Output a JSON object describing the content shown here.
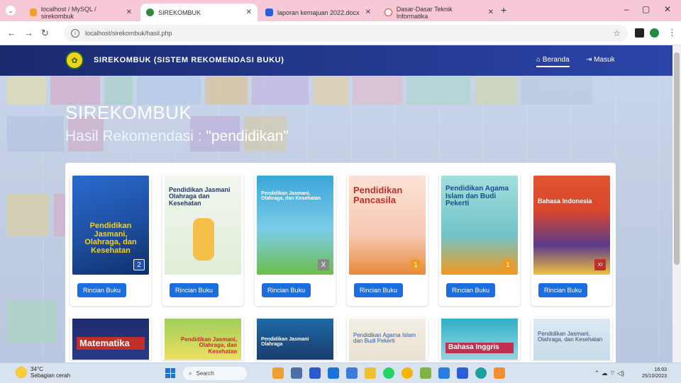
{
  "browser": {
    "tabs": [
      {
        "title": "localhost / MySQL / sirekombuk",
        "color": "#f0a030"
      },
      {
        "title": "SIREKOMBUK",
        "color": "#2e8b3a"
      },
      {
        "title": "laporan kemajuan 2022.docx",
        "color": "#2b5fd9"
      },
      {
        "title": "Dasar-Dasar Teknik Informatika",
        "color": "#e04040"
      }
    ],
    "url": "localhost/sirekombuk/hasil.php"
  },
  "site": {
    "brand": "SIREKOMBUK (SISTEM REKOMENDASI BUKU)",
    "nav": [
      {
        "label": "Beranda",
        "icon": "home-icon"
      },
      {
        "label": "Masuk",
        "icon": "login-icon"
      }
    ],
    "hero_title": "SIREKOMBUK",
    "hero_subtitle_prefix": "Hasil Rekomendasi : ",
    "hero_query": "\"pendidikan\"",
    "button_label": "Rincian Buku",
    "books_row1": [
      {
        "cover_title": "Pendidikan Jasmani, Olahraga, dan Kesehatan",
        "bg": "#1e4fa0",
        "fg": "#f5d020",
        "num": "2"
      },
      {
        "cover_title": "Pendidikan Jasmani Olahraga dan Kesehatan",
        "bg": "#e9f2e6",
        "fg": "#1f3a6e",
        "num": ""
      },
      {
        "cover_title": "Pendidikan Jasmani, Olahraga, dan Kesehatan",
        "bg": "#3aa6d8",
        "fg": "#ffffff",
        "num": "X"
      },
      {
        "cover_title": "Pendidikan Pancasila",
        "bg": "#f6c9b3",
        "fg": "#c0302a",
        "num": "1"
      },
      {
        "cover_title": "Pendidikan Agama Islam dan Budi Pekerti",
        "bg": "#6fc4c8",
        "fg": "#1c4d8a",
        "num": "1"
      },
      {
        "cover_title": "Bahasa Indonesia",
        "bg": "#d9472d",
        "fg": "#ffffff",
        "num": "XI"
      }
    ],
    "books_row2": [
      {
        "cover_title": "Matematika",
        "bg": "#1f2b6b",
        "fg": "#ffffff"
      },
      {
        "cover_title": "Pendidikan Jasmani, Olahraga, dan Kesehatan",
        "bg": "#9fcf5a",
        "fg": "#c0302a"
      },
      {
        "cover_title": "Pendidikan Jasmani Olahraga",
        "bg": "#1e6aa8",
        "fg": "#ffffff"
      },
      {
        "cover_title": "Pendidikan Agama Islam dan Budi Pekerti",
        "bg": "#f3eee4",
        "fg": "#2a5aa8"
      },
      {
        "cover_title": "Bahasa Inggris",
        "bg": "#2fb0c8",
        "fg": "#ffffff"
      },
      {
        "cover_title": "Pendidikan Jasmani, Olahraga, dan Kesehatan",
        "bg": "#dce9f2",
        "fg": "#2b4a7a"
      }
    ]
  },
  "taskbar": {
    "weather_temp": "34°C",
    "weather_desc": "Sebagian cerah",
    "search_placeholder": "Search",
    "time": "16:03",
    "date": "25/10/2023"
  }
}
